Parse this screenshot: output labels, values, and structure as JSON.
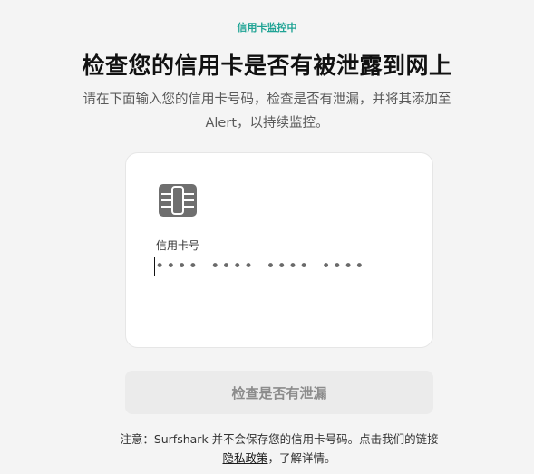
{
  "header": {
    "eyebrow": "信用卡监控中",
    "title": "检查您的信用卡是否有被泄露到网上",
    "subtitle": "请在下面输入您的信用卡号码，检查是否有泄漏，并将其添加至Alert，以持续监控。"
  },
  "card": {
    "chip_icon": "card-chip-icon",
    "field_label": "信用卡号",
    "input_placeholder": "•••• •••• •••• ••••",
    "input_value": ""
  },
  "actions": {
    "check_label": "检查是否有泄漏"
  },
  "footer": {
    "note_prefix": "注意：Surfshark 并不会保存您的信用卡号码。点击我们的链接",
    "privacy_link": "隐私政策",
    "note_suffix": "，了解详情。"
  }
}
